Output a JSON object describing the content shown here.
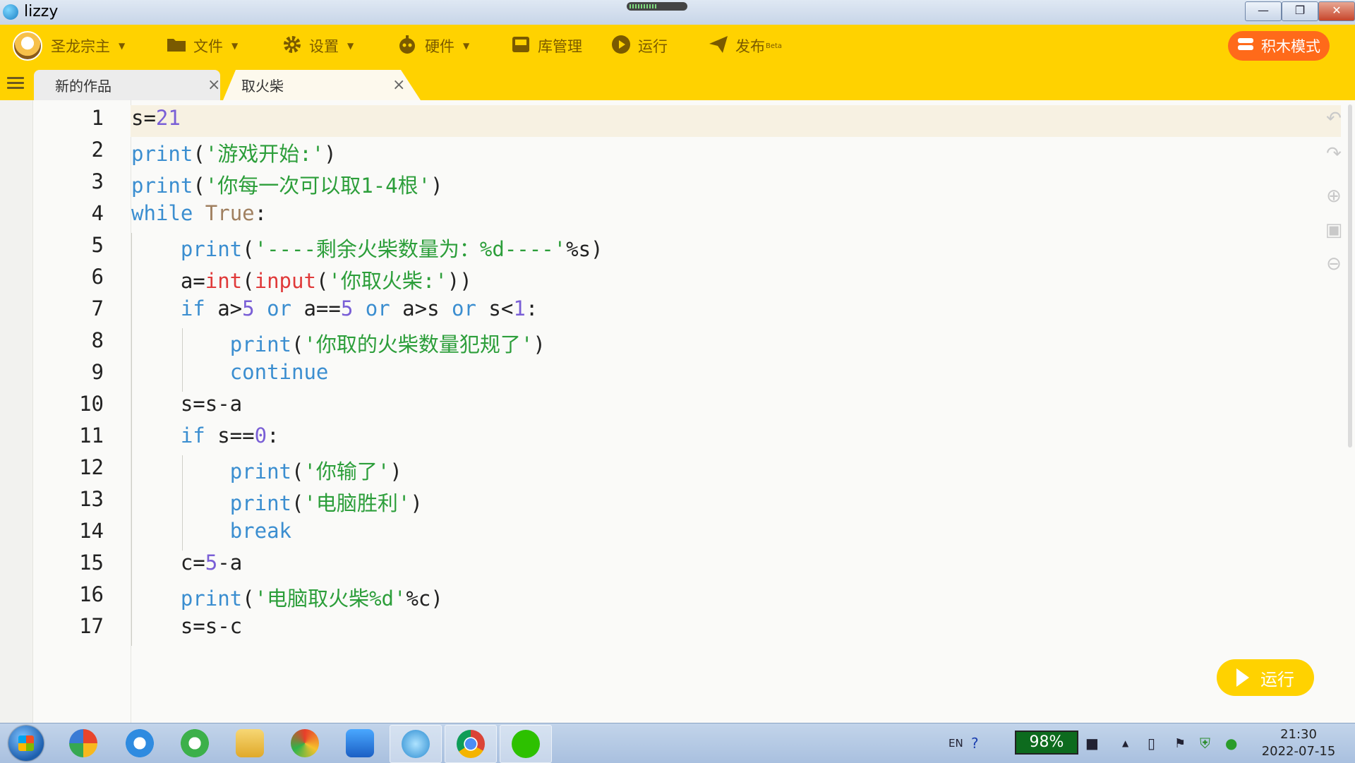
{
  "window": {
    "app_name": "lizzy"
  },
  "window_controls": {
    "minimize": "—",
    "maximize": "❐",
    "close": "✕"
  },
  "toolbar": {
    "user": "圣龙宗主",
    "file": "文件",
    "settings": "设置",
    "hardware": "硬件",
    "library": "库管理",
    "run": "运行",
    "publish": "发布",
    "publish_badge": "Beta",
    "block_mode": "积木模式"
  },
  "tabs": [
    {
      "label": "新的作品",
      "close": "×"
    },
    {
      "label": "取火柴",
      "close": "×"
    }
  ],
  "editor": {
    "line_numbers": [
      "1",
      "2",
      "3",
      "4",
      "5",
      "6",
      "7",
      "8",
      "9",
      "10",
      "11",
      "12",
      "13",
      "14",
      "15",
      "16",
      "17"
    ],
    "run_button": "运行"
  },
  "colors": {
    "accent": "#ffd200",
    "block_mode": "#ff6a1a",
    "keyword": "#3b8ed0",
    "string": "#2c9e3a",
    "number": "#7a5fd6",
    "builtin": "#e03a3a"
  },
  "taskbar": {
    "lang": "EN",
    "battery": "98%",
    "time": "21:30",
    "date": "2022-07-15"
  }
}
